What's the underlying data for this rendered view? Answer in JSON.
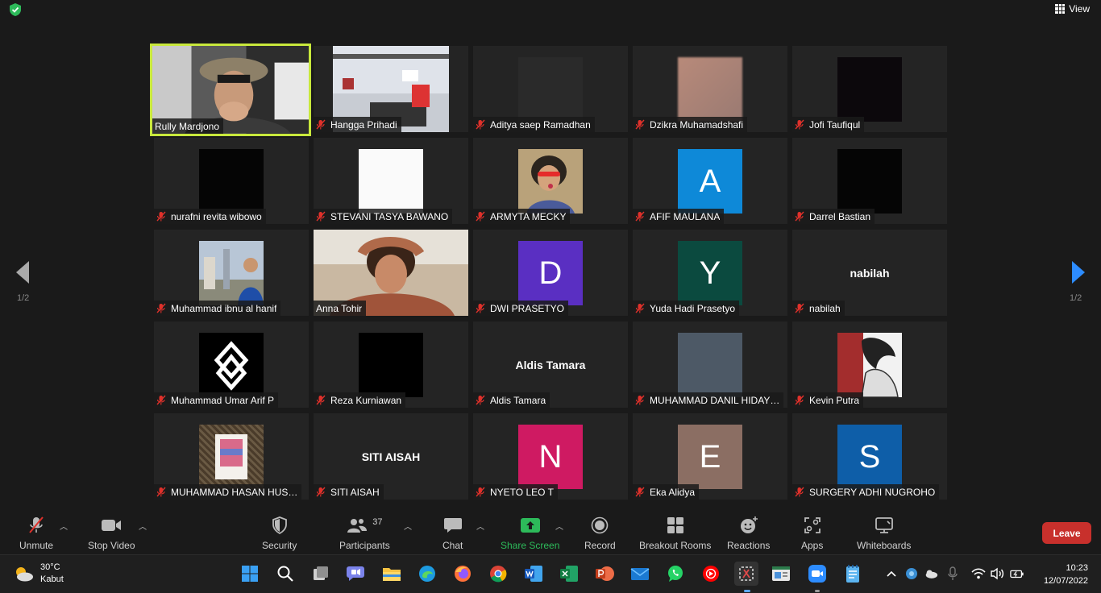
{
  "header": {
    "view_label": "View"
  },
  "participants": [
    {
      "name": "Rully Mardjono",
      "kind": "video",
      "active": true,
      "muted": false
    },
    {
      "name": "Hangga Prihadi",
      "kind": "video",
      "muted": true
    },
    {
      "name": "Aditya saep Ramadhan",
      "kind": "video",
      "muted": true
    },
    {
      "name": "Dzikra Muhamadshafi",
      "kind": "video",
      "muted": true
    },
    {
      "name": "Jofi Taufiqul",
      "kind": "video",
      "muted": true
    },
    {
      "name": "nurafni revita wibowo",
      "kind": "video",
      "muted": true
    },
    {
      "name": "STEVANI TASYA BAWANO",
      "kind": "video",
      "muted": true
    },
    {
      "name": "ARMYTA MECKY",
      "kind": "video",
      "muted": true
    },
    {
      "name": "AFIF MAULANA",
      "kind": "avatar",
      "letter": "A",
      "color": "#0e89d8",
      "muted": true
    },
    {
      "name": "Darrel Bastian",
      "kind": "video",
      "muted": true
    },
    {
      "name": "Muhammad ibnu al hanif",
      "kind": "video",
      "muted": true
    },
    {
      "name": "Anna Tohir",
      "kind": "video",
      "muted": false
    },
    {
      "name": "DWI PRASETYO",
      "kind": "avatar",
      "letter": "D",
      "color": "#5a2fc2",
      "muted": true
    },
    {
      "name": "Yuda Hadi Prasetyo",
      "kind": "avatar",
      "letter": "Y",
      "color": "#0b4a3f",
      "muted": true
    },
    {
      "name": "nabilah",
      "kind": "text",
      "muted": true
    },
    {
      "name": "Muhammad Umar Arif P",
      "kind": "logo",
      "muted": true
    },
    {
      "name": "Reza Kurniawan",
      "kind": "video",
      "muted": true
    },
    {
      "name": "Aldis Tamara",
      "kind": "text",
      "muted": true
    },
    {
      "name": "MUHAMMAD DANIL HIDAY…",
      "kind": "video",
      "muted": true
    },
    {
      "name": "Kevin Putra",
      "kind": "video",
      "muted": true
    },
    {
      "name": "MUHAMMAD HASAN HUS…",
      "kind": "video",
      "muted": true
    },
    {
      "name": "SITI AISAH",
      "kind": "text",
      "muted": true
    },
    {
      "name": "NYETO LEO T",
      "kind": "avatar",
      "letter": "N",
      "color": "#cf1a62",
      "muted": true
    },
    {
      "name": "Eka Alidya",
      "kind": "avatar",
      "letter": "E",
      "color": "#8b6e63",
      "muted": true
    },
    {
      "name": "SURGERY ADHI NUGROHO",
      "kind": "avatar",
      "letter": "S",
      "color": "#0e5ea8",
      "muted": true
    }
  ],
  "pager": {
    "left": "1/2",
    "right": "1/2"
  },
  "toolbar": {
    "unmute": "Unmute",
    "stop_video": "Stop Video",
    "security": "Security",
    "participants": "Participants",
    "participant_count": "37",
    "chat": "Chat",
    "share_screen": "Share Screen",
    "record": "Record",
    "breakout": "Breakout Rooms",
    "reactions": "Reactions",
    "apps": "Apps",
    "whiteboards": "Whiteboards",
    "leave": "Leave"
  },
  "taskbar": {
    "temp": "30°C",
    "weather": "Kabut",
    "time": "10:23",
    "date": "12/07/2022"
  },
  "colors": {
    "accent_green": "#2dba5a",
    "active_border": "#c8e83c",
    "leave": "#c8302c",
    "nav_arrow": "#2d8cff"
  }
}
